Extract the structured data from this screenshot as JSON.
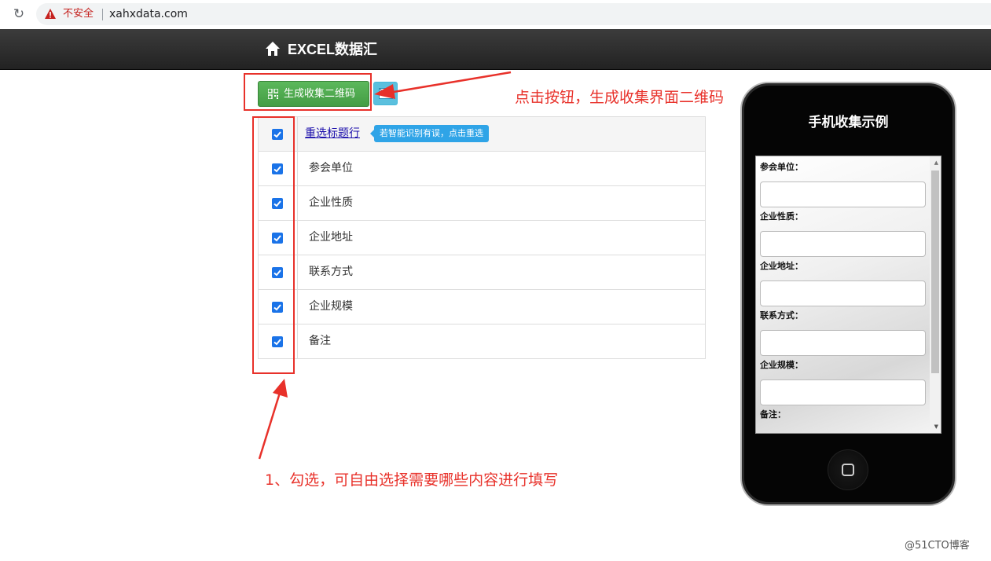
{
  "browser": {
    "security_label": "不安全",
    "url": "xahxdata.com"
  },
  "navbar": {
    "brand": "EXCEL数据汇"
  },
  "toolbar": {
    "generate_qr_label": "生成收集二维码"
  },
  "table": {
    "header_link": "重选标题行",
    "header_tip": "若智能识别有误，点击重选",
    "rows": [
      {
        "label": "参会单位",
        "checked": true
      },
      {
        "label": "企业性质",
        "checked": true
      },
      {
        "label": "企业地址",
        "checked": true
      },
      {
        "label": "联系方式",
        "checked": true
      },
      {
        "label": "企业规模",
        "checked": true
      },
      {
        "label": "备注",
        "checked": true
      }
    ]
  },
  "annotations": {
    "button_hint": "点击按钮，生成收集界面二维码",
    "check_hint": "1、勾选，可自由选择需要哪些内容进行填写"
  },
  "phone_preview": {
    "title": "手机收集示例",
    "fields": [
      "参会单位：",
      "企业性质：",
      "企业地址：",
      "联系方式：",
      "企业规模：",
      "备注："
    ]
  },
  "watermark": "@51CTO博客",
  "colors": {
    "accent_red": "#e8312a",
    "button_green": "#5cb85c",
    "button_info": "#5bc0de",
    "tooltip_blue": "#2fa4e7",
    "checkbox_blue": "#1a73e8"
  }
}
